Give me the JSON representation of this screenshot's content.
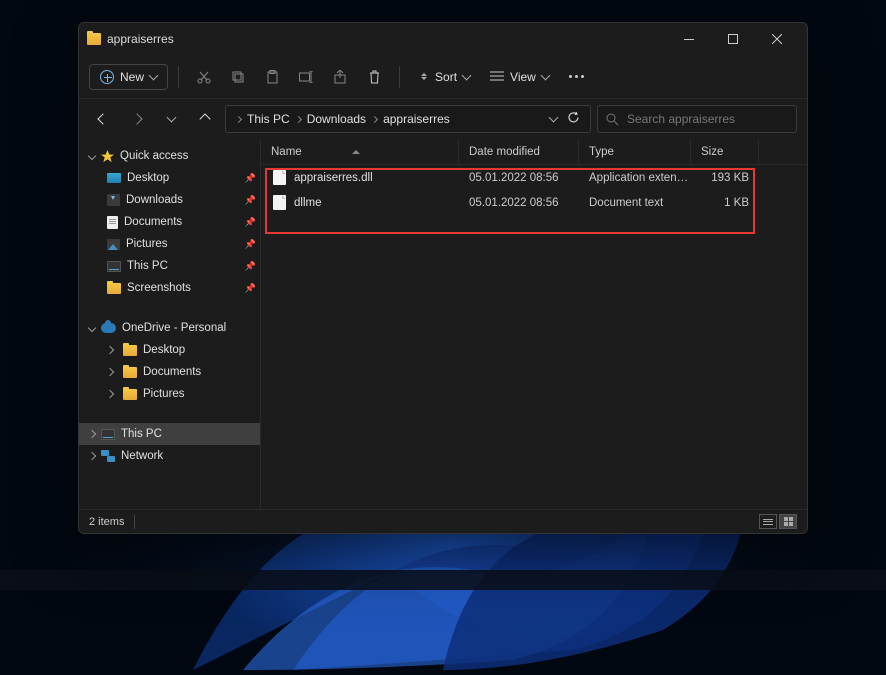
{
  "window": {
    "title": "appraiserres"
  },
  "toolbar": {
    "new_label": "New",
    "sort_label": "Sort",
    "view_label": "View"
  },
  "breadcrumb": {
    "seg1": "This PC",
    "seg2": "Downloads",
    "seg3": "appraiserres"
  },
  "search": {
    "placeholder": "Search appraiserres"
  },
  "sidebar": {
    "quick_access": "Quick access",
    "desktop": "Desktop",
    "downloads": "Downloads",
    "documents": "Documents",
    "pictures": "Pictures",
    "this_pc": "This PC",
    "screenshots": "Screenshots",
    "onedrive": "OneDrive - Personal",
    "od_desktop": "Desktop",
    "od_documents": "Documents",
    "od_pictures": "Pictures",
    "this_pc_main": "This PC",
    "network": "Network"
  },
  "columns": {
    "name": "Name",
    "date": "Date modified",
    "type": "Type",
    "size": "Size"
  },
  "files": [
    {
      "name": "appraiserres.dll",
      "date": "05.01.2022 08:56",
      "type": "Application extens...",
      "size": "193 KB"
    },
    {
      "name": "dllme",
      "date": "05.01.2022 08:56",
      "type": "Document text",
      "size": "1 KB"
    }
  ],
  "status": {
    "count": "2 items"
  }
}
